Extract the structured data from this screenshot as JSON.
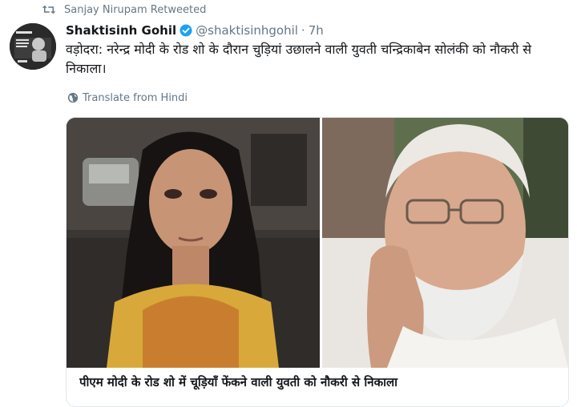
{
  "retweet": {
    "text": "Sanjay Nirupam Retweeted",
    "icon": "retweet-icon"
  },
  "tweet": {
    "author_name": "Shaktisinh Gohil",
    "verified": true,
    "handle": "@shaktisinhgohil",
    "separator": "·",
    "time": "7h",
    "text": "वड़ोदरा: नरेन्द्र मोदी के रोड शो के दौरान चुड़ियां उछालने वाली युवती चन्द्रिकाबेन सोलंकी को नौकरी से निकाला।",
    "translate_label": "Translate from Hindi",
    "translate_icon": "globe-icon"
  },
  "card": {
    "title": "पीएम मोदी के रोड शो में चूड़ियाँ फेंकने वाली युवती को नौकरी से निकाला"
  },
  "colors": {
    "secondary_text": "#657786",
    "verified_blue": "#1da1f2",
    "border": "#e1e8ed"
  }
}
